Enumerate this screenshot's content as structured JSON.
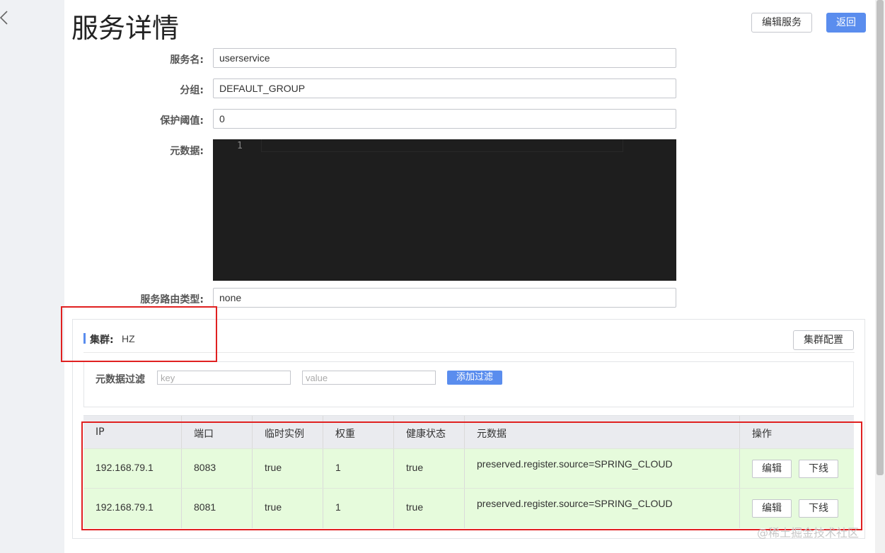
{
  "header": {
    "title": "服务详情",
    "edit_service_label": "编辑服务",
    "back_label": "返回"
  },
  "form": {
    "service_name_label": "服务名:",
    "service_name_value": "userservice",
    "group_label": "分组:",
    "group_value": "DEFAULT_GROUP",
    "threshold_label": "保护阈值:",
    "threshold_value": "0",
    "metadata_label": "元数据:",
    "metadata_line_number": "1",
    "route_type_label": "服务路由类型:",
    "route_type_value": "none"
  },
  "cluster": {
    "title": "集群:",
    "name": "HZ",
    "config_label": "集群配置"
  },
  "filter": {
    "label": "元数据过滤",
    "key_placeholder": "key",
    "value_placeholder": "value",
    "add_label": "添加过滤"
  },
  "table": {
    "columns": [
      "IP",
      "端口",
      "临时实例",
      "权重",
      "健康状态",
      "元数据",
      "操作"
    ],
    "rows": [
      {
        "ip": "192.168.79.1",
        "port": "8083",
        "ephemeral": "true",
        "weight": "1",
        "healthy": "true",
        "metadata": "preserved.register.source=SPRING_CLOUD",
        "edit": "编辑",
        "offline": "下线"
      },
      {
        "ip": "192.168.79.1",
        "port": "8081",
        "ephemeral": "true",
        "weight": "1",
        "healthy": "true",
        "metadata": "preserved.register.source=SPRING_CLOUD",
        "edit": "编辑",
        "offline": "下线"
      }
    ]
  },
  "watermark": "@稀土掘金技术社区",
  "colors": {
    "primary": "#5a8dee",
    "row_healthy": "#e6fbdc",
    "annotation": "#e02020",
    "editor_bg": "#1e1e1e"
  }
}
